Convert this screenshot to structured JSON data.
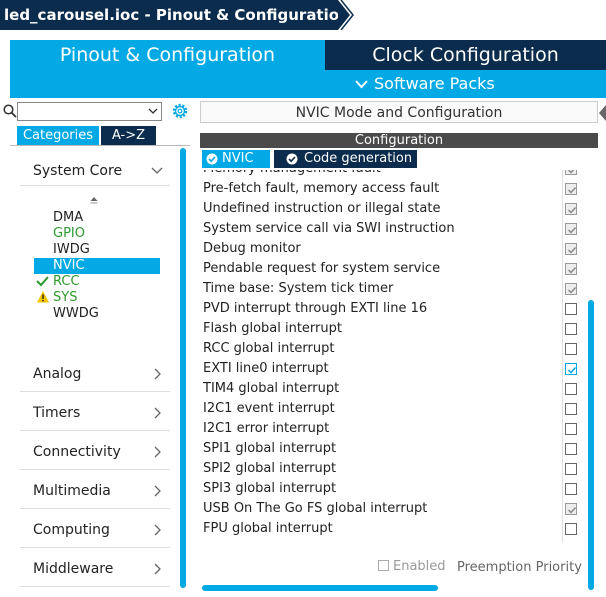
{
  "breadcrumb": {
    "title": "led_carousel.ioc - Pinout & Configuration"
  },
  "tabs": {
    "pinout": "Pinout & Configuration",
    "clock": "Clock Configuration"
  },
  "software_packs": "Software Packs",
  "left": {
    "search": {
      "value": "",
      "placeholder": ""
    },
    "tab_categories": "Categories",
    "tab_az": "A->Z",
    "categories": [
      "System Core",
      "Analog",
      "Timers",
      "Connectivity",
      "Multimedia",
      "Computing",
      "Middleware"
    ],
    "system_core_items": [
      {
        "label": "DMA",
        "status": ""
      },
      {
        "label": "GPIO",
        "status": "green"
      },
      {
        "label": "IWDG",
        "status": ""
      },
      {
        "label": "NVIC",
        "status": "selected"
      },
      {
        "label": "RCC",
        "status": "ok"
      },
      {
        "label": "SYS",
        "status": "warning"
      },
      {
        "label": "WWDG",
        "status": ""
      }
    ]
  },
  "right": {
    "title": "NVIC Mode and Configuration",
    "configuration": "Configuration",
    "subtab_nvic": "NVIC",
    "subtab_code": "Code generation",
    "rows": [
      {
        "label": "Memory management fault",
        "checked": true
      },
      {
        "label": "Pre-fetch fault, memory access fault",
        "checked": true
      },
      {
        "label": "Undefined instruction or illegal state",
        "checked": true
      },
      {
        "label": "System service call via SWI instruction",
        "checked": true
      },
      {
        "label": "Debug monitor",
        "checked": true
      },
      {
        "label": "Pendable request for system service",
        "checked": true
      },
      {
        "label": "Time base: System tick timer",
        "checked": true
      },
      {
        "label": "PVD interrupt through EXTI line 16",
        "checked": false
      },
      {
        "label": "Flash global interrupt",
        "checked": false
      },
      {
        "label": "RCC global interrupt",
        "checked": false
      },
      {
        "label": "EXTI line0 interrupt",
        "checked": true,
        "active": true
      },
      {
        "label": "TIM4 global interrupt",
        "checked": false
      },
      {
        "label": "I2C1 event interrupt",
        "checked": false
      },
      {
        "label": "I2C1 error interrupt",
        "checked": false
      },
      {
        "label": "SPI1 global interrupt",
        "checked": false
      },
      {
        "label": "SPI2 global interrupt",
        "checked": false
      },
      {
        "label": "SPI3 global interrupt",
        "checked": false
      },
      {
        "label": "USB On The Go FS global interrupt",
        "checked": true
      },
      {
        "label": "FPU global interrupt",
        "checked": false
      }
    ],
    "enabled_label": "Enabled",
    "preemption_label": "Preemption Priority"
  },
  "colors": {
    "accent": "#03a9e4",
    "dark": "#0b2c4c",
    "ok": "#2d9b2d",
    "warning": "#f5c400"
  }
}
